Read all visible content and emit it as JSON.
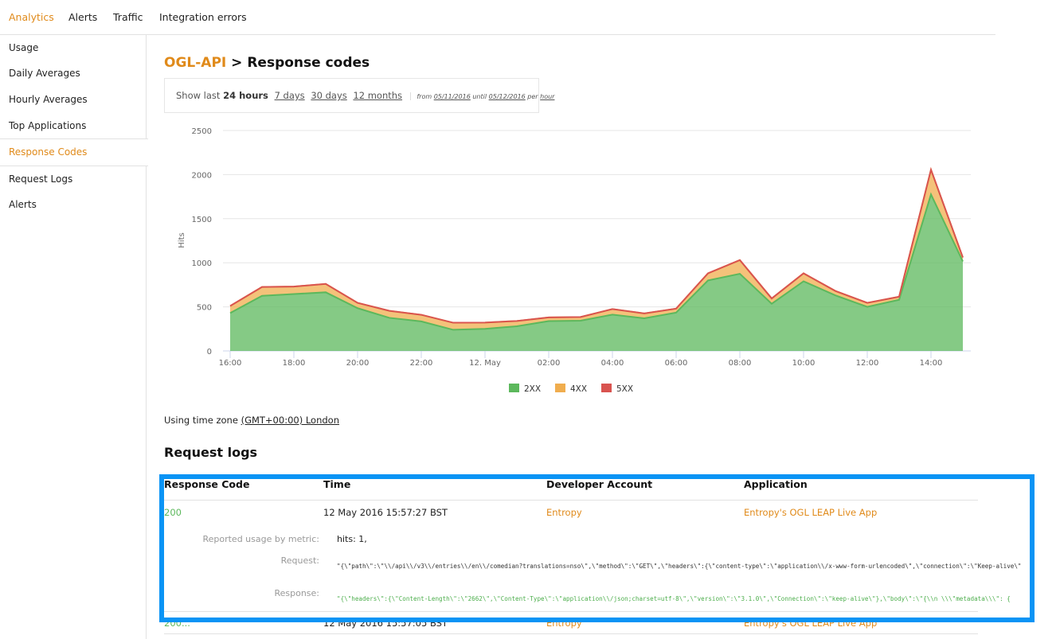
{
  "topnav": {
    "items": [
      {
        "label": "Analytics",
        "active": true
      },
      {
        "label": "Alerts",
        "active": false
      },
      {
        "label": "Traffic",
        "active": false
      },
      {
        "label": "Integration errors",
        "active": false
      }
    ]
  },
  "sidebar": {
    "items": [
      {
        "label": "Usage"
      },
      {
        "label": "Daily Averages"
      },
      {
        "label": "Hourly Averages"
      },
      {
        "label": "Top Applications"
      },
      {
        "label": "Response Codes",
        "active": true
      },
      {
        "label": "Request Logs"
      },
      {
        "label": "Alerts"
      }
    ]
  },
  "page": {
    "api_name": "OGL-API",
    "separator": " > ",
    "title": "Response codes"
  },
  "range": {
    "prefix": "Show last",
    "selected": "24 hours",
    "options": [
      "7 days",
      "30 days",
      "12 months"
    ],
    "from_label": "from",
    "from_date": "05/11/2016",
    "until_label": "until",
    "until_date": "05/12/2016",
    "per_label": "per",
    "granularity": "hour"
  },
  "timezone": {
    "prefix": "Using time zone",
    "value": "(GMT+00:00) London"
  },
  "request_logs": {
    "title": "Request logs",
    "columns": [
      "Response Code",
      "Time",
      "Developer Account",
      "Application"
    ],
    "rows": [
      {
        "code": "200",
        "time": "12 May 2016 15:57:27 BST",
        "account": "Entropy",
        "application": "Entropy's OGL LEAP Live App",
        "expanded": true,
        "usage_label": "Reported usage by metric:",
        "usage_value": "hits: 1,",
        "request_label": "Request:",
        "request_value": "\"{\\\"path\\\":\\\"\\\\/api\\\\/v3\\\\/entries\\\\/en\\\\/comedian?translations=nso\\\",\\\"method\\\":\\\"GET\\\",\\\"headers\\\":{\\\"content-type\\\":\\\"application\\\\/x-www-form-urlencoded\\\",\\\"connection\\\":\\\"Keep-alive\\\"",
        "response_label": "Response:",
        "response_value": "\"{\\\"headers\\\":{\\\"Content-Length\\\":\\\"2662\\\",\\\"Content-Type\\\":\\\"application\\\\/json;charset=utf-8\\\",\\\"version\\\":\\\"3.1.0\\\",\\\"Connection\\\":\\\"keep-alive\\\"},\\\"body\\\":\\\"{\\\\n    \\\\\\\"metadata\\\\\\\": {"
      },
      {
        "code": "200...",
        "time": "12 May 2016 15:57:05 BST",
        "account": "Entropy",
        "application": "Entropy's OGL LEAP Live App",
        "expanded": false
      }
    ]
  },
  "colors": {
    "accent": "#e08a1a",
    "2xx": "#5cb85c",
    "4xx": "#f0ad4e",
    "5xx": "#d9534f",
    "highlight": "#0a94f5"
  },
  "chart_data": {
    "type": "area",
    "stacked": true,
    "title": "",
    "xlabel": "",
    "ylabel": "Hits",
    "ylim": [
      0,
      2500
    ],
    "yticks": [
      0,
      500,
      1000,
      1500,
      2000,
      2500
    ],
    "x": [
      "16:00",
      "17:00",
      "18:00",
      "19:00",
      "20:00",
      "21:00",
      "22:00",
      "23:00",
      "12. May",
      "01:00",
      "02:00",
      "03:00",
      "04:00",
      "05:00",
      "06:00",
      "07:00",
      "08:00",
      "09:00",
      "10:00",
      "11:00",
      "12:00",
      "13:00",
      "14:00",
      "15:00"
    ],
    "xtick_labels": [
      "16:00",
      "18:00",
      "20:00",
      "22:00",
      "12. May",
      "02:00",
      "04:00",
      "06:00",
      "08:00",
      "10:00",
      "12:00",
      "14:00"
    ],
    "grid": true,
    "legend": "bottom-center",
    "series": [
      {
        "name": "2XX",
        "color": "#5cb85c",
        "values": [
          430,
          625,
          645,
          665,
          485,
          375,
          335,
          240,
          250,
          280,
          338,
          343,
          412,
          370,
          435,
          800,
          875,
          535,
          790,
          630,
          500,
          580,
          1775,
          1015
        ]
      },
      {
        "name": "4XX",
        "color": "#f0ad4e",
        "values": [
          80,
          100,
          85,
          95,
          60,
          80,
          75,
          80,
          72,
          60,
          42,
          42,
          63,
          55,
          45,
          80,
          155,
          60,
          90,
          50,
          45,
          35,
          280,
          45
        ]
      },
      {
        "name": "5XX",
        "color": "#d9534f",
        "values": [
          0,
          0,
          0,
          0,
          0,
          0,
          0,
          0,
          0,
          0,
          0,
          0,
          0,
          0,
          0,
          0,
          0,
          0,
          0,
          0,
          0,
          0,
          0,
          0
        ]
      }
    ]
  }
}
